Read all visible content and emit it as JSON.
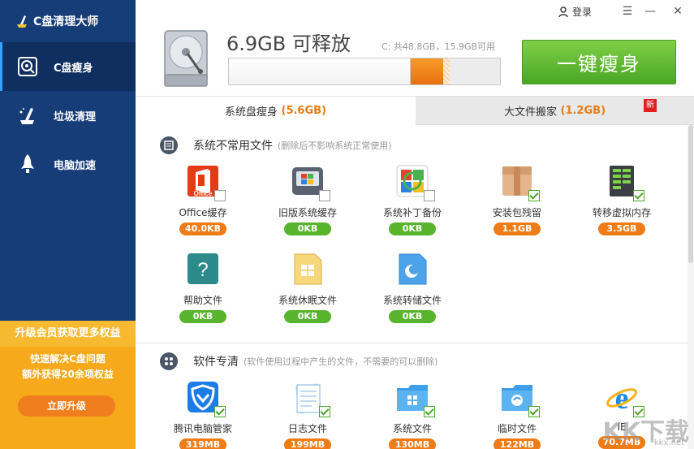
{
  "app": {
    "title": "C盘清理大师"
  },
  "sidebar": {
    "items": [
      {
        "label": "C盘瘦身"
      },
      {
        "label": "垃圾清理"
      },
      {
        "label": "电脑加速"
      }
    ],
    "promo": {
      "title": "升级会员获取更多权益",
      "line1": "快速解决C盘问题",
      "line2": "额外获得20余项权益",
      "button": "立即升级"
    }
  },
  "header": {
    "login": "登录",
    "free_space": "6.9GB 可释放",
    "disk_info": "C: 共48.8GB，15.9GB可用",
    "usage": {
      "used_fraction": 0.67,
      "free_fraction": 0.12
    },
    "button": "一键瘦身"
  },
  "tabs": [
    {
      "label": "系统盘瘦身",
      "size": "5.6GB"
    },
    {
      "label": "大文件搬家",
      "size": "1.2GB",
      "badge": "新"
    }
  ],
  "sections": [
    {
      "title": "系统不常用文件",
      "desc": "(删除后不影响系统正常使用)",
      "items": [
        {
          "label": "Office缓存",
          "size": "40.0KB",
          "checked": false,
          "icon": "office-icon"
        },
        {
          "label": "旧版系统缓存",
          "size": "0KB",
          "checked": false,
          "icon": "old-system-icon"
        },
        {
          "label": "系统补丁备份",
          "size": "0KB",
          "checked": false,
          "icon": "patch-backup-icon"
        },
        {
          "label": "安装包残留",
          "size": "1.1GB",
          "checked": true,
          "icon": "package-box-icon"
        },
        {
          "label": "转移虚拟内存",
          "size": "3.5GB",
          "checked": true,
          "icon": "memory-chip-icon"
        },
        {
          "label": "帮助文件",
          "size": "0KB",
          "checked": false,
          "icon": "help-icon"
        },
        {
          "label": "系统休眠文件",
          "size": "0KB",
          "checked": false,
          "icon": "hibernate-file-icon"
        },
        {
          "label": "系统转储文件",
          "size": "0KB",
          "checked": false,
          "icon": "dump-file-icon"
        }
      ]
    },
    {
      "title": "软件专清",
      "desc": "(软件使用过程中产生的文件，不需要的可以删除)",
      "items": [
        {
          "label": "腾讯电脑管家",
          "size": "319MB",
          "checked": true,
          "icon": "tencent-shield-icon"
        },
        {
          "label": "日志文件",
          "size": "199MB",
          "checked": true,
          "icon": "log-file-icon"
        },
        {
          "label": "系统文件",
          "size": "130MB",
          "checked": true,
          "icon": "system-folder-icon"
        },
        {
          "label": "临时文件",
          "size": "122MB",
          "checked": true,
          "icon": "temp-folder-icon"
        },
        {
          "label": "IE",
          "size": "70.7MB",
          "checked": true,
          "icon": "ie-icon"
        }
      ]
    }
  ],
  "colors": {
    "sidebar": "#173d78",
    "accent_green": "#58b42c",
    "accent_orange": "#ef7c16"
  },
  "watermark": {
    "text": "KK下载",
    "url": "kkx.net"
  }
}
